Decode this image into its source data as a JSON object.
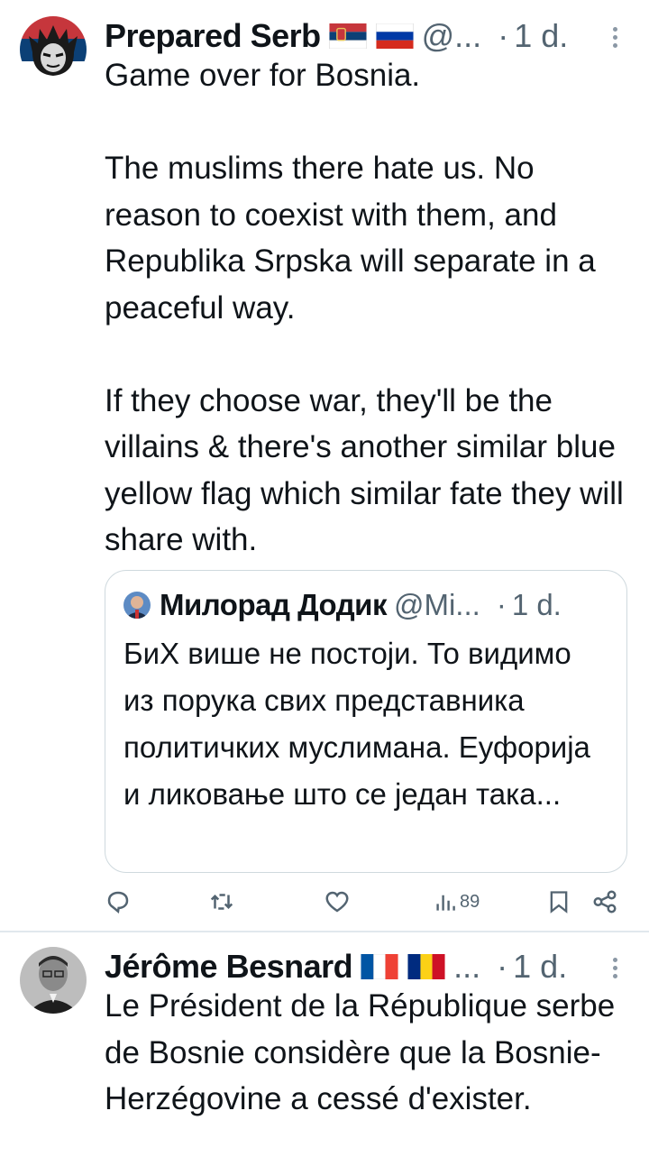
{
  "tweets": [
    {
      "avatar": "berserk-avatar",
      "name": "Prepared Serb",
      "flags": [
        "serbia-flag",
        "russia-flag"
      ],
      "handle": "@...",
      "separator": "·",
      "time": "1 d.",
      "text": "Game over for Bosnia.\n\nThe muslims there hate us. No reason to coexist with them, and Republika Srpska will separate in a peaceful way.\n\nIf they choose war, they'll be the villains & there's another similar blue yellow flag which similar fate they will share with.",
      "quote": {
        "avatar": "dodik-avatar",
        "name": "Милорад Додик",
        "handle": "@Mi...",
        "separator": "·",
        "time": "1 d.",
        "text": "БиХ више не постоји. То видимо из порука свих представника политичких муслимана. Еуфорија и ликовање што се један така..."
      },
      "actions": {
        "reply_icon": "reply-icon",
        "retweet_icon": "retweet-icon",
        "like_icon": "like-icon",
        "views_icon": "views-icon",
        "views_count": "89",
        "bookmark_icon": "bookmark-icon",
        "share_icon": "share-icon"
      }
    },
    {
      "avatar": "besnard-avatar",
      "name": "Jérôme Besnard",
      "flags": [
        "france-flag",
        "romania-flag"
      ],
      "handle": "...",
      "separator": "·",
      "time": "1 d.",
      "text": "Le Président de la République serbe de Bosnie considère que la Bosnie-Herzégovine a cessé d'exister."
    }
  ],
  "colors": {
    "text": "#0f1419",
    "secondary": "#536471",
    "border": "#cfd9de",
    "divider": "#e1e8ed"
  }
}
